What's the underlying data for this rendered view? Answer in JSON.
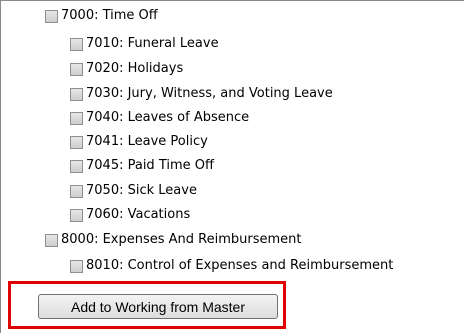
{
  "tree": {
    "items": [
      {
        "label": "7000: Time Off",
        "level": 0
      },
      {
        "label": "7010: Funeral Leave",
        "level": 1
      },
      {
        "label": "7020: Holidays",
        "level": 1
      },
      {
        "label": "7030: Jury, Witness, and Voting Leave",
        "level": 1
      },
      {
        "label": "7040: Leaves of Absence",
        "level": 1
      },
      {
        "label": "7041: Leave Policy",
        "level": 1
      },
      {
        "label": "7045: Paid Time Off",
        "level": 1
      },
      {
        "label": "7050: Sick Leave",
        "level": 1
      },
      {
        "label": "7060: Vacations",
        "level": 1
      },
      {
        "label": "8000: Expenses And Reimbursement",
        "level": 0
      },
      {
        "label": "8010: Control of Expenses and Reimbursement",
        "level": 1
      }
    ]
  },
  "actions": {
    "add_label": "Add to Working from Master"
  },
  "colors": {
    "highlight": "#e00000"
  }
}
